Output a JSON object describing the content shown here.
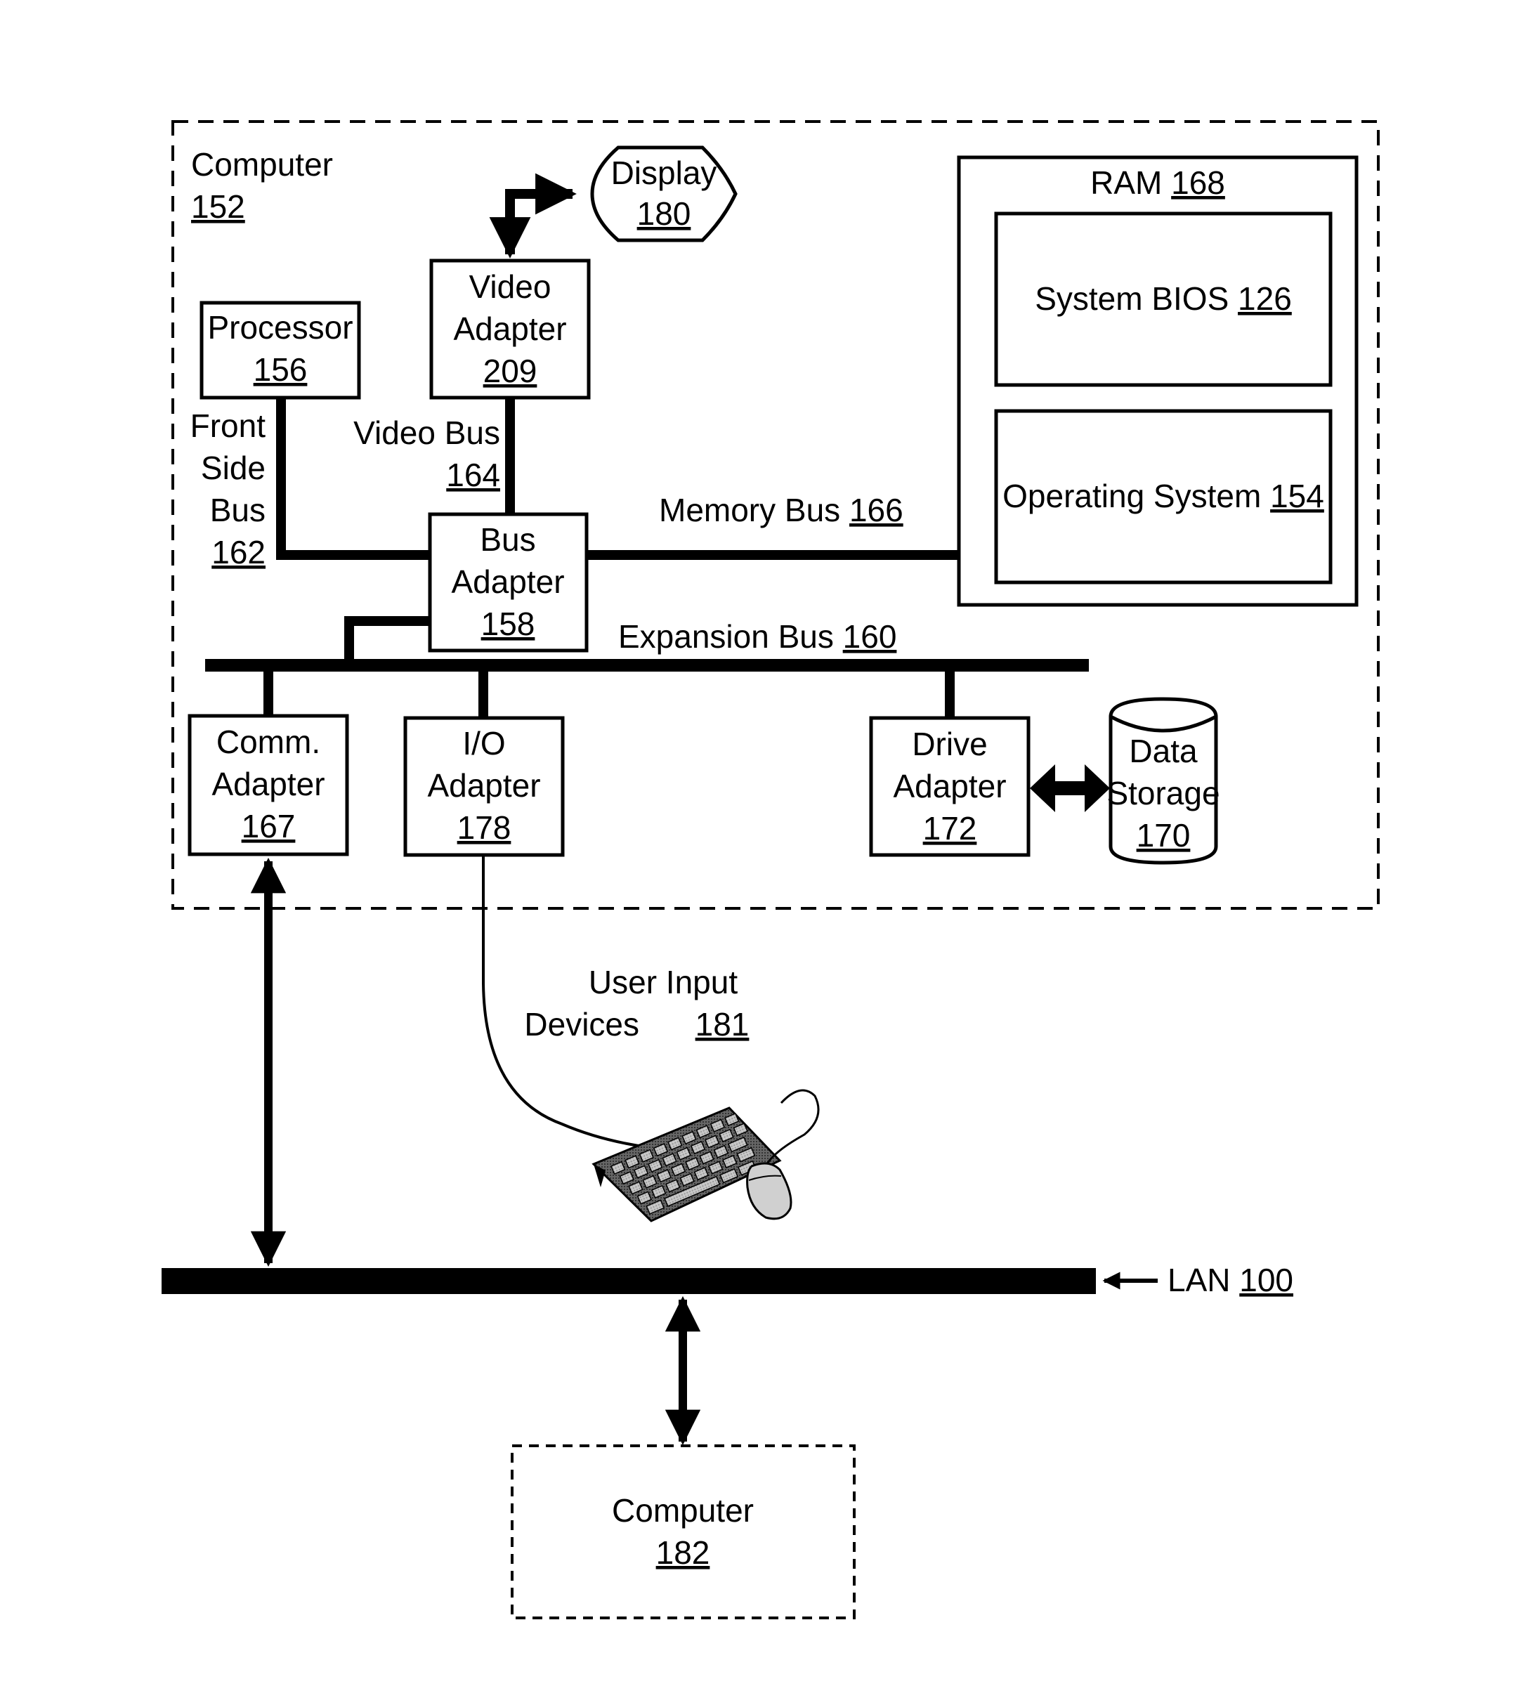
{
  "figure": {
    "computer_main": {
      "label": "Computer",
      "ref": "152"
    },
    "display": {
      "label": "Display",
      "ref": "180"
    },
    "processor": {
      "label": "Processor",
      "ref": "156"
    },
    "video_adapter": {
      "line1": "Video",
      "line2": "Adapter",
      "ref": "209"
    },
    "ram": {
      "label": "RAM",
      "ref": "168"
    },
    "system_bios": {
      "label": "System BIOS",
      "ref": "126"
    },
    "operating_system": {
      "label": "Operating System",
      "ref": "154"
    },
    "front_side_bus": {
      "line1": "Front",
      "line2": "Side",
      "line3": "Bus",
      "ref": "162"
    },
    "video_bus": {
      "label": "Video Bus",
      "ref": "164"
    },
    "memory_bus": {
      "label": "Memory Bus",
      "ref": "166"
    },
    "bus_adapter": {
      "line1": "Bus",
      "line2": "Adapter",
      "ref": "158"
    },
    "expansion_bus": {
      "label": "Expansion Bus",
      "ref": "160"
    },
    "comm_adapter": {
      "line1": "Comm.",
      "line2": "Adapter",
      "ref": "167"
    },
    "io_adapter": {
      "line1": "I/O",
      "line2": "Adapter",
      "ref": "178"
    },
    "drive_adapter": {
      "line1": "Drive",
      "line2": "Adapter",
      "ref": "172"
    },
    "data_storage": {
      "line1": "Data",
      "line2": "Storage",
      "ref": "170"
    },
    "user_input": {
      "line1": "User Input",
      "line2": "Devices",
      "ref": "181"
    },
    "lan": {
      "label": "LAN",
      "ref": "100"
    },
    "computer_remote": {
      "label": "Computer",
      "ref": "182"
    }
  }
}
